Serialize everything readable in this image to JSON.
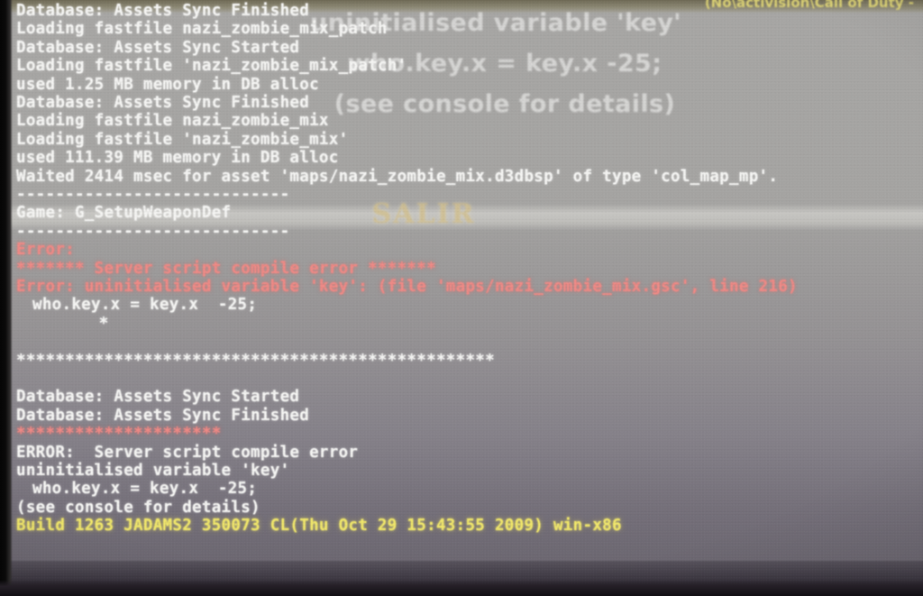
{
  "window": {
    "title_strip": "(No\\activision\\Call of Duty -"
  },
  "game_dialog": {
    "line1": "uninitialised variable 'key'",
    "line2": "who.key.x = key.x  -25;",
    "line3": "(see console for details)",
    "exit_button": "SALIR"
  },
  "console": {
    "text_colors": {
      "white": "#f7f7f5",
      "red": "#f08a86",
      "yellow": "#f2e86a"
    },
    "lines": [
      {
        "text": "Database: Assets Sync Finished",
        "color": "white",
        "indent": 0
      },
      {
        "text": "Loading fastfile nazi_zombie_mix_patch",
        "color": "white",
        "indent": 0
      },
      {
        "text": "Database: Assets Sync Started",
        "color": "white",
        "indent": 0
      },
      {
        "text": "Loading fastfile 'nazi_zombie_mix_patch'",
        "color": "white",
        "indent": 0
      },
      {
        "text": "used 1.25 MB memory in DB alloc",
        "color": "white",
        "indent": 0
      },
      {
        "text": "Database: Assets Sync Finished",
        "color": "white",
        "indent": 0
      },
      {
        "text": "Loading fastfile nazi_zombie_mix",
        "color": "white",
        "indent": 0
      },
      {
        "text": "Loading fastfile 'nazi_zombie_mix'",
        "color": "white",
        "indent": 0
      },
      {
        "text": "used 111.39 MB memory in DB alloc",
        "color": "white",
        "indent": 0
      },
      {
        "text": "Waited 2414 msec for asset 'maps/nazi_zombie_mix.d3dbsp' of type 'col_map_mp'.",
        "color": "white",
        "indent": 0
      },
      {
        "text": "----------------------------",
        "color": "white",
        "indent": 0
      },
      {
        "text": "Game: G_SetupWeaponDef",
        "color": "white",
        "indent": 0
      },
      {
        "text": "----------------------------",
        "color": "white",
        "indent": 0
      },
      {
        "text": "Error:",
        "color": "red",
        "indent": 0
      },
      {
        "text": "******* Server script compile error *******",
        "color": "red",
        "indent": 0
      },
      {
        "text": "Error: uninitialised variable 'key': (file 'maps/nazi_zombie_mix.gsc', line 216)",
        "color": "red",
        "indent": 0
      },
      {
        "text": "who.key.x = key.x  -25;",
        "color": "white",
        "indent": 1
      },
      {
        "text": "*",
        "color": "white",
        "indent": 9
      },
      {
        "text": "",
        "color": "white",
        "indent": 0
      },
      {
        "text": "*************************************************",
        "color": "white",
        "indent": 0
      },
      {
        "text": "",
        "color": "white",
        "indent": 0
      },
      {
        "text": "Database: Assets Sync Started",
        "color": "white",
        "indent": 0
      },
      {
        "text": "Database: Assets Sync Finished",
        "color": "white",
        "indent": 0
      },
      {
        "text": "*********************",
        "color": "red",
        "indent": 0
      },
      {
        "text": "ERROR:  Server script compile error",
        "color": "white",
        "indent": 0
      },
      {
        "text": "uninitialised variable 'key'",
        "color": "white",
        "indent": 0
      },
      {
        "text": "who.key.x = key.x  -25;",
        "color": "white",
        "indent": 1
      },
      {
        "text": "(see console for details)",
        "color": "white",
        "indent": 0
      },
      {
        "text": "Build 1263 JADAMS2 350073 CL(Thu Oct 29 15:43:55 2009) win-x86",
        "color": "yellow",
        "indent": 0
      }
    ]
  }
}
